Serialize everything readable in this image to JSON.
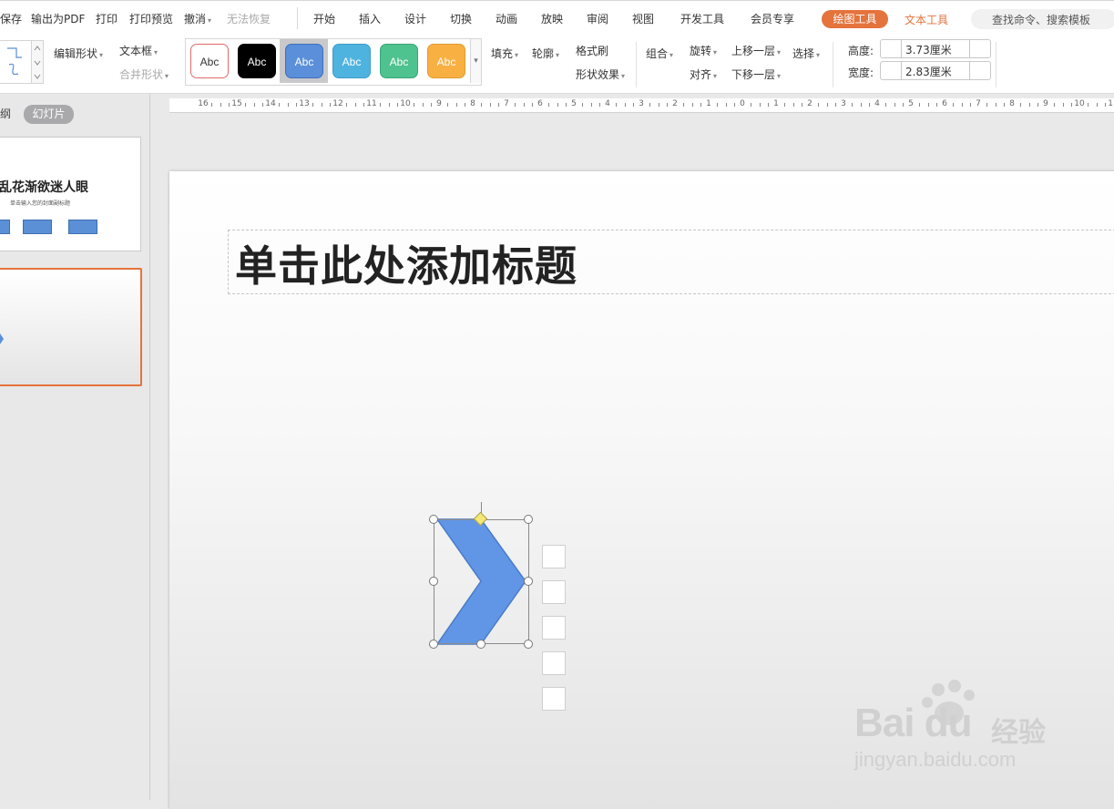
{
  "menubar": {
    "items": [
      {
        "label": "保存"
      },
      {
        "label": "输出为PDF"
      },
      {
        "label": "打印"
      },
      {
        "label": "打印预览"
      },
      {
        "label": "撤消"
      },
      {
        "label": "无法恢复"
      },
      {
        "label": "开始"
      },
      {
        "label": "插入"
      },
      {
        "label": "设计"
      },
      {
        "label": "切换"
      },
      {
        "label": "动画"
      },
      {
        "label": "放映"
      },
      {
        "label": "审阅"
      },
      {
        "label": "视图"
      },
      {
        "label": "开发工具"
      },
      {
        "label": "会员专享"
      }
    ],
    "active_tab": "绘图工具",
    "text_tool_tab": "文本工具",
    "search_placeholder": "查找命令、搜索模板"
  },
  "ribbon": {
    "edit_shape": "编辑形状",
    "text_box": "文本框",
    "merge_shape": "合并形状",
    "style_buttons": [
      {
        "label": "Abc",
        "fill": "#ffffff",
        "border": "#e26a6a",
        "text": "#333333"
      },
      {
        "label": "Abc",
        "fill": "#000000",
        "border": "#000000",
        "text": "#ffffff"
      },
      {
        "label": "Abc",
        "fill": "#5b8fd9",
        "border": "#3d6fbd",
        "text": "#ffffff"
      },
      {
        "label": "Abc",
        "fill": "#4fb3e0",
        "border": "#3a9ccb",
        "text": "#ffffff"
      },
      {
        "label": "Abc",
        "fill": "#4ec28f",
        "border": "#38a677",
        "text": "#ffffff"
      },
      {
        "label": "Abc",
        "fill": "#f9b043",
        "border": "#e39a2a",
        "text": "#ffffff"
      }
    ],
    "fill": "填充",
    "outline": "轮廓",
    "format_painter": "格式刷",
    "shape_effects": "形状效果",
    "group": "组合",
    "rotate": "旋转",
    "align": "对齐",
    "bring_forward": "上移一层",
    "send_backward": "下移一层",
    "select": "选择",
    "height_label": "高度:",
    "height_value": "3.73厘米",
    "width_label": "宽度:",
    "width_value": "2.83厘米"
  },
  "leftpanel": {
    "outline_tab": "纲",
    "slides_tab": "幻灯片",
    "thumb1_title": "乱花渐欲迷人眼",
    "thumb1_subtitle": "单击输入您的封面副标题"
  },
  "ruler": {
    "labels": [
      "16",
      "15",
      "14",
      "13",
      "12",
      "11",
      "10",
      "9",
      "8",
      "7",
      "6",
      "5",
      "4",
      "3",
      "2",
      "1",
      "0",
      "1",
      "2",
      "3",
      "4",
      "5",
      "6",
      "7",
      "8",
      "9",
      "10",
      "11"
    ]
  },
  "slide": {
    "title_placeholder": "单击此处添加标题",
    "shape_fill": "#6196e6",
    "shape_stroke": "#4a7cc7"
  },
  "watermark": {
    "brand": "Bai du",
    "jingyan": "经验",
    "url": "jingyan.baidu.com"
  }
}
